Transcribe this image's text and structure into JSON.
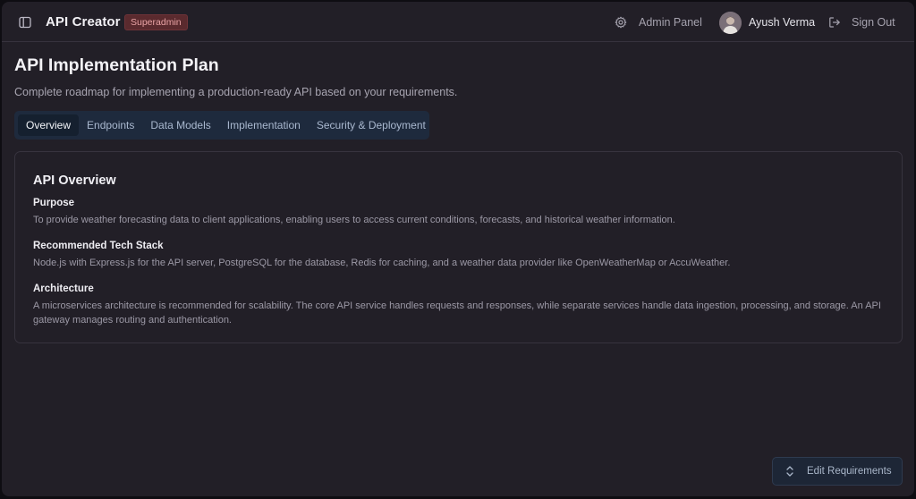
{
  "header": {
    "app_title": "API Creator",
    "role_badge": "Superadmin",
    "admin_panel_label": "Admin Panel",
    "user_name": "Ayush Verma",
    "sign_out_label": "Sign Out"
  },
  "page": {
    "title": "API Implementation Plan",
    "subtitle": "Complete roadmap for implementing a production-ready API based on your requirements."
  },
  "tabs": [
    {
      "label": "Overview",
      "active": true
    },
    {
      "label": "Endpoints",
      "active": false
    },
    {
      "label": "Data Models",
      "active": false
    },
    {
      "label": "Implementation",
      "active": false
    },
    {
      "label": "Security & Deployment",
      "active": false
    }
  ],
  "overview": {
    "title": "API Overview",
    "sections": [
      {
        "heading": "Purpose",
        "body": "To provide weather forecasting data to client applications, enabling users to access current conditions, forecasts, and historical weather information."
      },
      {
        "heading": "Recommended Tech Stack",
        "body": "Node.js with Express.js for the API server, PostgreSQL for the database, Redis for caching, and a weather data provider like OpenWeatherMap or AccuWeather."
      },
      {
        "heading": "Architecture",
        "body": "A microservices architecture is recommended for scalability. The core API service handles requests and responses, while separate services handle data ingestion, processing, and storage. An API gateway manages routing and authentication."
      }
    ]
  },
  "actions": {
    "edit_label": "Edit Requirements"
  },
  "icons": {
    "sidebar_toggle": "sidebar-panel-icon",
    "admin_panel": "gear-icon",
    "sign_out": "logout-icon",
    "edit": "chevrons-up-down-icon"
  },
  "colors": {
    "background": "#221f27",
    "tab_bar": "#1e2a3d",
    "badge_bg": "#5a2a2e",
    "badge_text": "#e9a3a5"
  }
}
